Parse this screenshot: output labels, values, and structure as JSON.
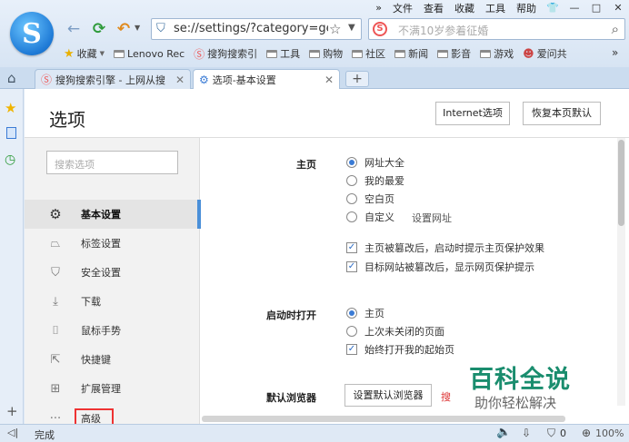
{
  "menu": {
    "items": [
      "文件",
      "查看",
      "收藏",
      "工具",
      "帮助"
    ]
  },
  "nav": {
    "back": "←",
    "refresh": "⟳",
    "undo": "↶"
  },
  "address": {
    "url": "se://settings/?category=gen"
  },
  "search": {
    "placeholder": "不满10岁参着征婚"
  },
  "bookmarks": {
    "items": [
      "收藏",
      "Lenovo Rec",
      "搜狗搜索引",
      "工具",
      "购物",
      "社区",
      "新闻",
      "影音",
      "游戏",
      "爱问共"
    ]
  },
  "tabs": [
    {
      "label": "搜狗搜索引擎 - 上网从搜"
    },
    {
      "label": "选项-基本设置"
    }
  ],
  "newtab": "+",
  "page": {
    "title": "选项",
    "btn_internet": "Internet选项",
    "btn_restore": "恢复本页默认"
  },
  "leftnav": {
    "search_placeholder": "搜索选项",
    "items": [
      "基本设置",
      "标签设置",
      "安全设置",
      "下载",
      "鼠标手势",
      "快捷键",
      "扩展管理",
      "高级"
    ]
  },
  "settings": {
    "home": {
      "label": "主页",
      "options": [
        "网址大全",
        "我的最爱",
        "空白页",
        "自定义"
      ],
      "set_url": "设置网址",
      "checks": [
        "主页被篡改后，启动时提示主页保护效果",
        "目标网站被篡改后，显示网页保护提示"
      ]
    },
    "startup": {
      "label": "启动时打开",
      "options": [
        "主页",
        "上次未关闭的页面"
      ],
      "check": "始终打开我的起始页"
    },
    "default_browser": {
      "label": "默认浏览器",
      "button": "设置默认浏览器",
      "note": "搜"
    }
  },
  "status": {
    "text": "完成",
    "badge": "0",
    "zoom": "100%"
  },
  "watermark": {
    "line1": "百科全说",
    "line2": "助你轻松解决"
  }
}
